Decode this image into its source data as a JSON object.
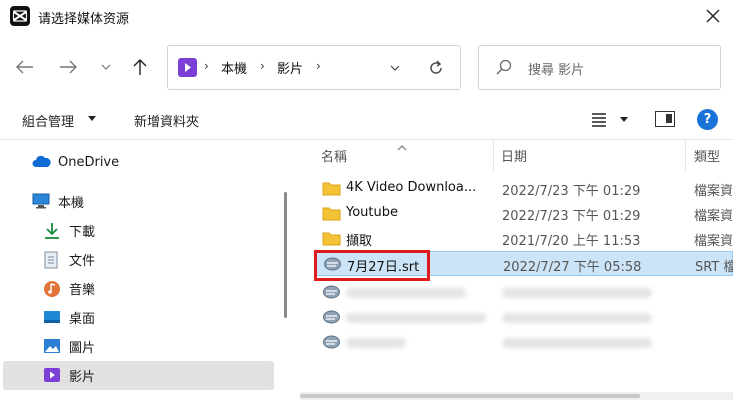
{
  "window": {
    "title": "请选择媒体资源",
    "close_icon": "close-icon",
    "app_icon": "capcut-logo-icon"
  },
  "navigation": {
    "back_icon": "arrow-left-icon",
    "forward_icon": "arrow-right-icon",
    "recent_icon": "chevron-down-icon",
    "up_icon": "arrow-up-icon",
    "address": {
      "crumbs": [
        "本機",
        "影片"
      ],
      "refresh_icon": "refresh-icon",
      "dropdown_icon": "chevron-down-icon"
    },
    "search": {
      "placeholder": "搜尋 影片"
    }
  },
  "toolbar": {
    "organize_label": "組合管理",
    "new_folder_label": "新增資料夾"
  },
  "sidebar": {
    "items": [
      {
        "label": "OneDrive",
        "icon": "cloud-icon"
      },
      {
        "label": "本機",
        "icon": "computer-icon"
      },
      {
        "label": "下載",
        "icon": "download-icon"
      },
      {
        "label": "文件",
        "icon": "document-icon"
      },
      {
        "label": "音樂",
        "icon": "music-icon"
      },
      {
        "label": "桌面",
        "icon": "desktop-icon"
      },
      {
        "label": "圖片",
        "icon": "pictures-icon"
      },
      {
        "label": "影片",
        "icon": "videos-icon"
      }
    ]
  },
  "file_list": {
    "columns": [
      "名稱",
      "日期",
      "類型"
    ],
    "rows": [
      {
        "name": "4K Video Downloa...",
        "date": "2022/7/23 下午 01:29",
        "type": "檔案資",
        "icon": "folder-icon"
      },
      {
        "name": "Youtube",
        "date": "2022/7/23 下午 01:29",
        "type": "檔案資",
        "icon": "folder-icon"
      },
      {
        "name": "擷取",
        "date": "2021/7/20 上午 11:53",
        "type": "檔案資",
        "icon": "folder-icon"
      },
      {
        "name": "7月27日.srt",
        "date": "2022/7/27 下午 05:58",
        "type": "SRT 檔",
        "icon": "srt-file-icon"
      }
    ]
  },
  "colors": {
    "selected_row": "#cce4f7",
    "highlight_border": "#e0191d",
    "accent": "#1a73d9",
    "folder": "#f4c236"
  }
}
